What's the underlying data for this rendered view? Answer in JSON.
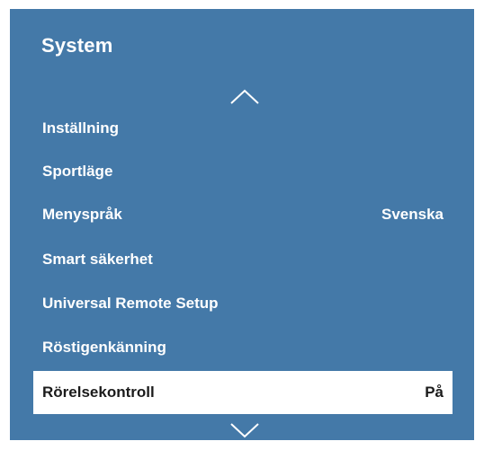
{
  "menu": {
    "title": "System",
    "items": [
      {
        "label": "Inställning",
        "value": ""
      },
      {
        "label": "Sportläge",
        "value": ""
      },
      {
        "label": "Menyspråk",
        "value": "Svenska"
      },
      {
        "label": "Smart säkerhet",
        "value": ""
      },
      {
        "label": "Universal Remote Setup",
        "value": ""
      },
      {
        "label": "Röstigenkänning",
        "value": ""
      },
      {
        "label": "Rörelsekontroll",
        "value": "På"
      }
    ],
    "selected_item": "Rörelsekontroll",
    "scroll_up_icon": "chevron-up-icon",
    "scroll_down_icon": "chevron-down-icon"
  },
  "colors": {
    "panel_background": "#4479a8",
    "text": "#ffffff",
    "selected_background": "#ffffff",
    "selected_text": "#1b1b1b"
  }
}
